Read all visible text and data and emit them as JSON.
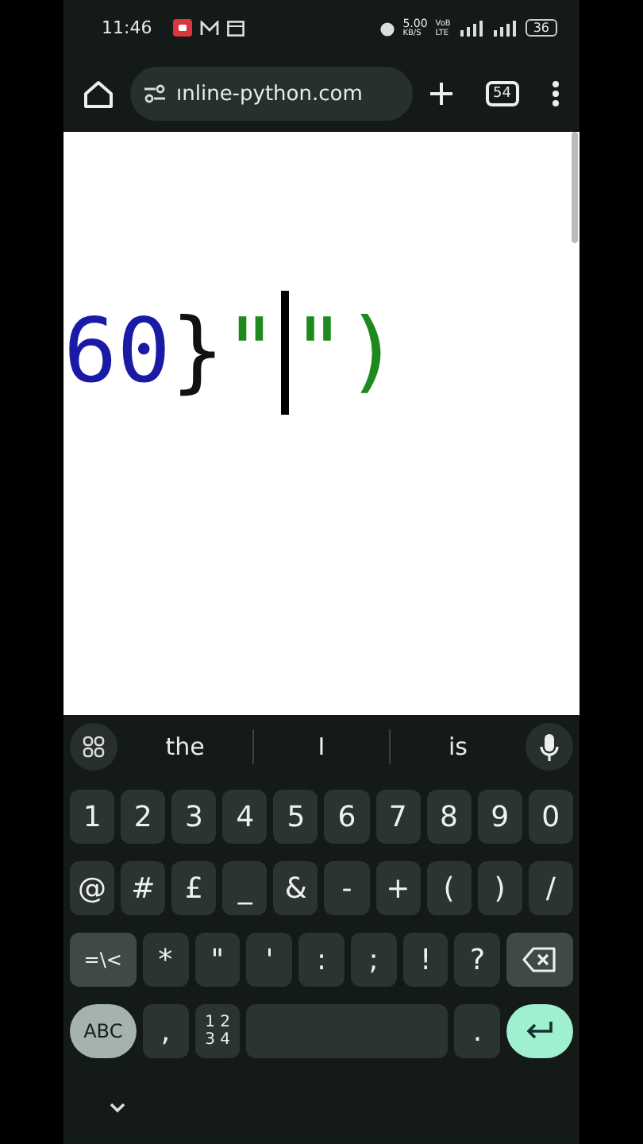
{
  "status_bar": {
    "time": "11:46",
    "speed": "5.00",
    "speed_unit": "KB/S",
    "volte_top": "VoB",
    "volte_bottom": "LTE",
    "battery": "36"
  },
  "browser": {
    "url": "ınline-python.com",
    "tab_count": "54"
  },
  "code_tokens": [
    {
      "text": "60",
      "color": "#1a1aa6"
    },
    {
      "text": "}",
      "color": "#111111"
    },
    {
      "text": "\"",
      "color": "#1e8a1e"
    },
    {
      "kind": "cursor"
    },
    {
      "text": "\"",
      "color": "#1e8a1e"
    },
    {
      "text": ")",
      "color": "#1e8a1e"
    }
  ],
  "keyboard": {
    "suggestions": [
      "the",
      "I",
      "is"
    ],
    "rows": [
      [
        {
          "kind": "char",
          "label": "1"
        },
        {
          "kind": "char",
          "label": "2"
        },
        {
          "kind": "char",
          "label": "3"
        },
        {
          "kind": "char",
          "label": "4"
        },
        {
          "kind": "char",
          "label": "5"
        },
        {
          "kind": "char",
          "label": "6"
        },
        {
          "kind": "char",
          "label": "7"
        },
        {
          "kind": "char",
          "label": "8"
        },
        {
          "kind": "char",
          "label": "9"
        },
        {
          "kind": "char",
          "label": "0"
        }
      ],
      [
        {
          "kind": "char",
          "label": "@"
        },
        {
          "kind": "char",
          "label": "#"
        },
        {
          "kind": "char",
          "label": "£"
        },
        {
          "kind": "char",
          "label": "_"
        },
        {
          "kind": "char",
          "label": "&"
        },
        {
          "kind": "char",
          "label": "-"
        },
        {
          "kind": "char",
          "label": "+"
        },
        {
          "kind": "char",
          "label": "("
        },
        {
          "kind": "char",
          "label": ")"
        },
        {
          "kind": "char",
          "label": "/"
        }
      ],
      [
        {
          "kind": "toggle",
          "label": "=\\<"
        },
        {
          "kind": "char",
          "label": "*"
        },
        {
          "kind": "char",
          "label": "\""
        },
        {
          "kind": "char",
          "label": "'"
        },
        {
          "kind": "char",
          "label": ":"
        },
        {
          "kind": "char",
          "label": ";"
        },
        {
          "kind": "char",
          "label": "!"
        },
        {
          "kind": "char",
          "label": "?"
        },
        {
          "kind": "backspace"
        }
      ],
      [
        {
          "kind": "abc",
          "label": "ABC"
        },
        {
          "kind": "char",
          "label": ","
        },
        {
          "kind": "numpad",
          "lines": [
            "1 2",
            "3 4"
          ]
        },
        {
          "kind": "space"
        },
        {
          "kind": "char",
          "label": "."
        },
        {
          "kind": "enter"
        }
      ]
    ]
  }
}
